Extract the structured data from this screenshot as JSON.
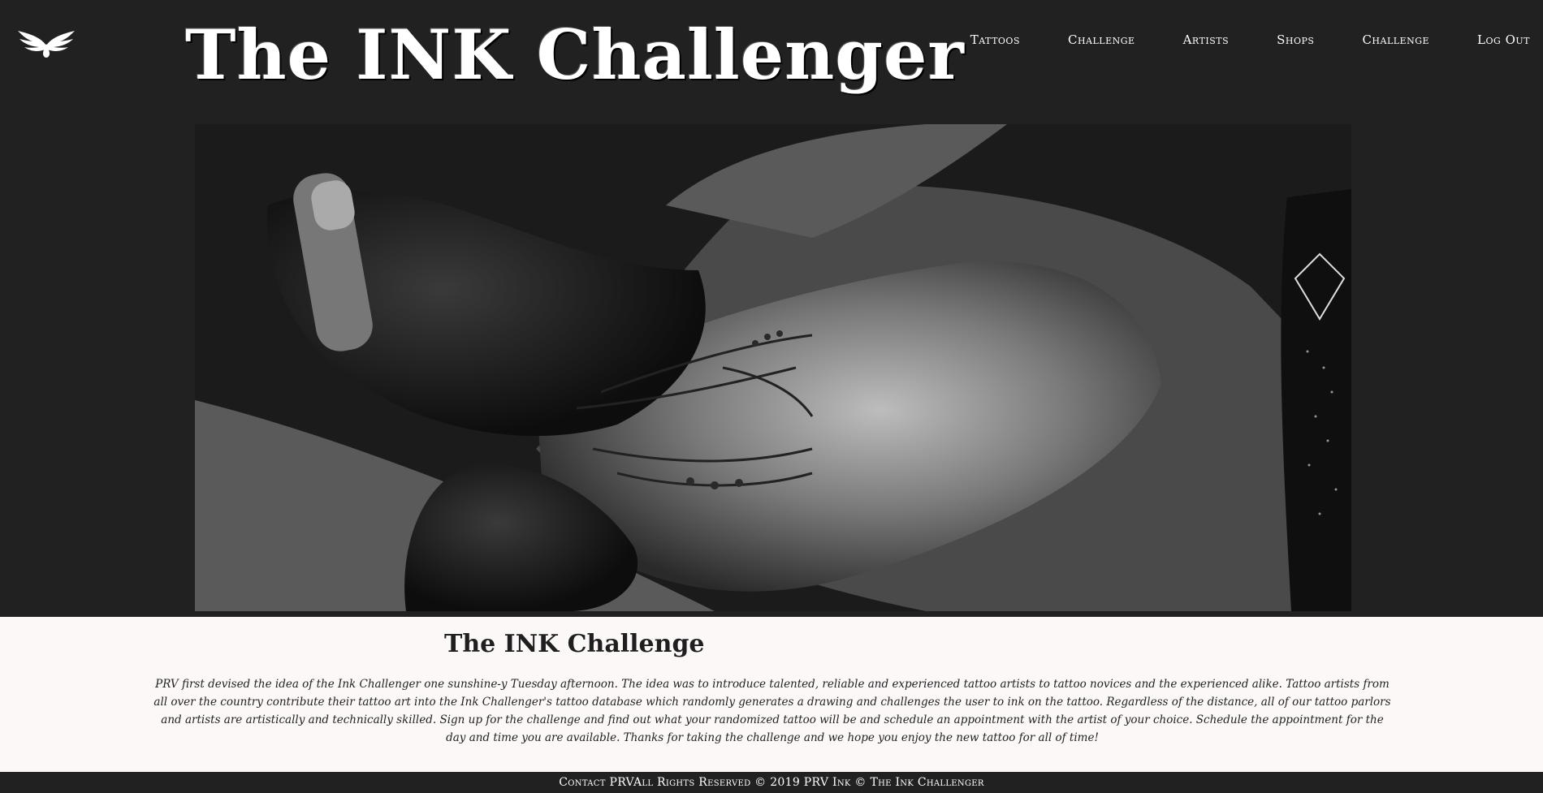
{
  "header": {
    "title": "The INK Challenger",
    "logo_icon": "winged-ink-drop-logo-icon",
    "nav": [
      {
        "label": "Tattoos"
      },
      {
        "label": "Challenge"
      },
      {
        "label": "Artists"
      },
      {
        "label": "Shops"
      },
      {
        "label": "Challenge"
      },
      {
        "label": "Log Out"
      }
    ]
  },
  "hero": {
    "image": "tattoo-artist-inking-arm-photo"
  },
  "main": {
    "heading": "The INK Challenge",
    "description": "PRV first devised the idea of the Ink Challenger one sunshine-y Tuesday afternoon. The idea was to introduce talented, reliable and experienced tattoo artists to tattoo novices and the experienced alike. Tattoo artists from all over the country contribute their tattoo art into the Ink Challenger's tattoo database which randomly generates a drawing and challenges the user to ink on the tattoo. Regardless of the distance, all of our tattoo parlors and artists are artistically and technically skilled. Sign up for the challenge and find out what your randomized tattoo will be and schedule an appointment with the artist of your choice. Schedule the appointment for the day and time you are available. Thanks for taking the challenge and we hope you enjoy the new tattoo for all of time!"
  },
  "footer": {
    "text": "Contact PRVAll Rights Reserved © 2019 PRV Ink © The Ink Challenger"
  },
  "colors": {
    "header_bg": "#212121",
    "content_bg": "#fdf8f8",
    "text_light": "#ffffff",
    "text_dark": "#1f1f1f"
  }
}
